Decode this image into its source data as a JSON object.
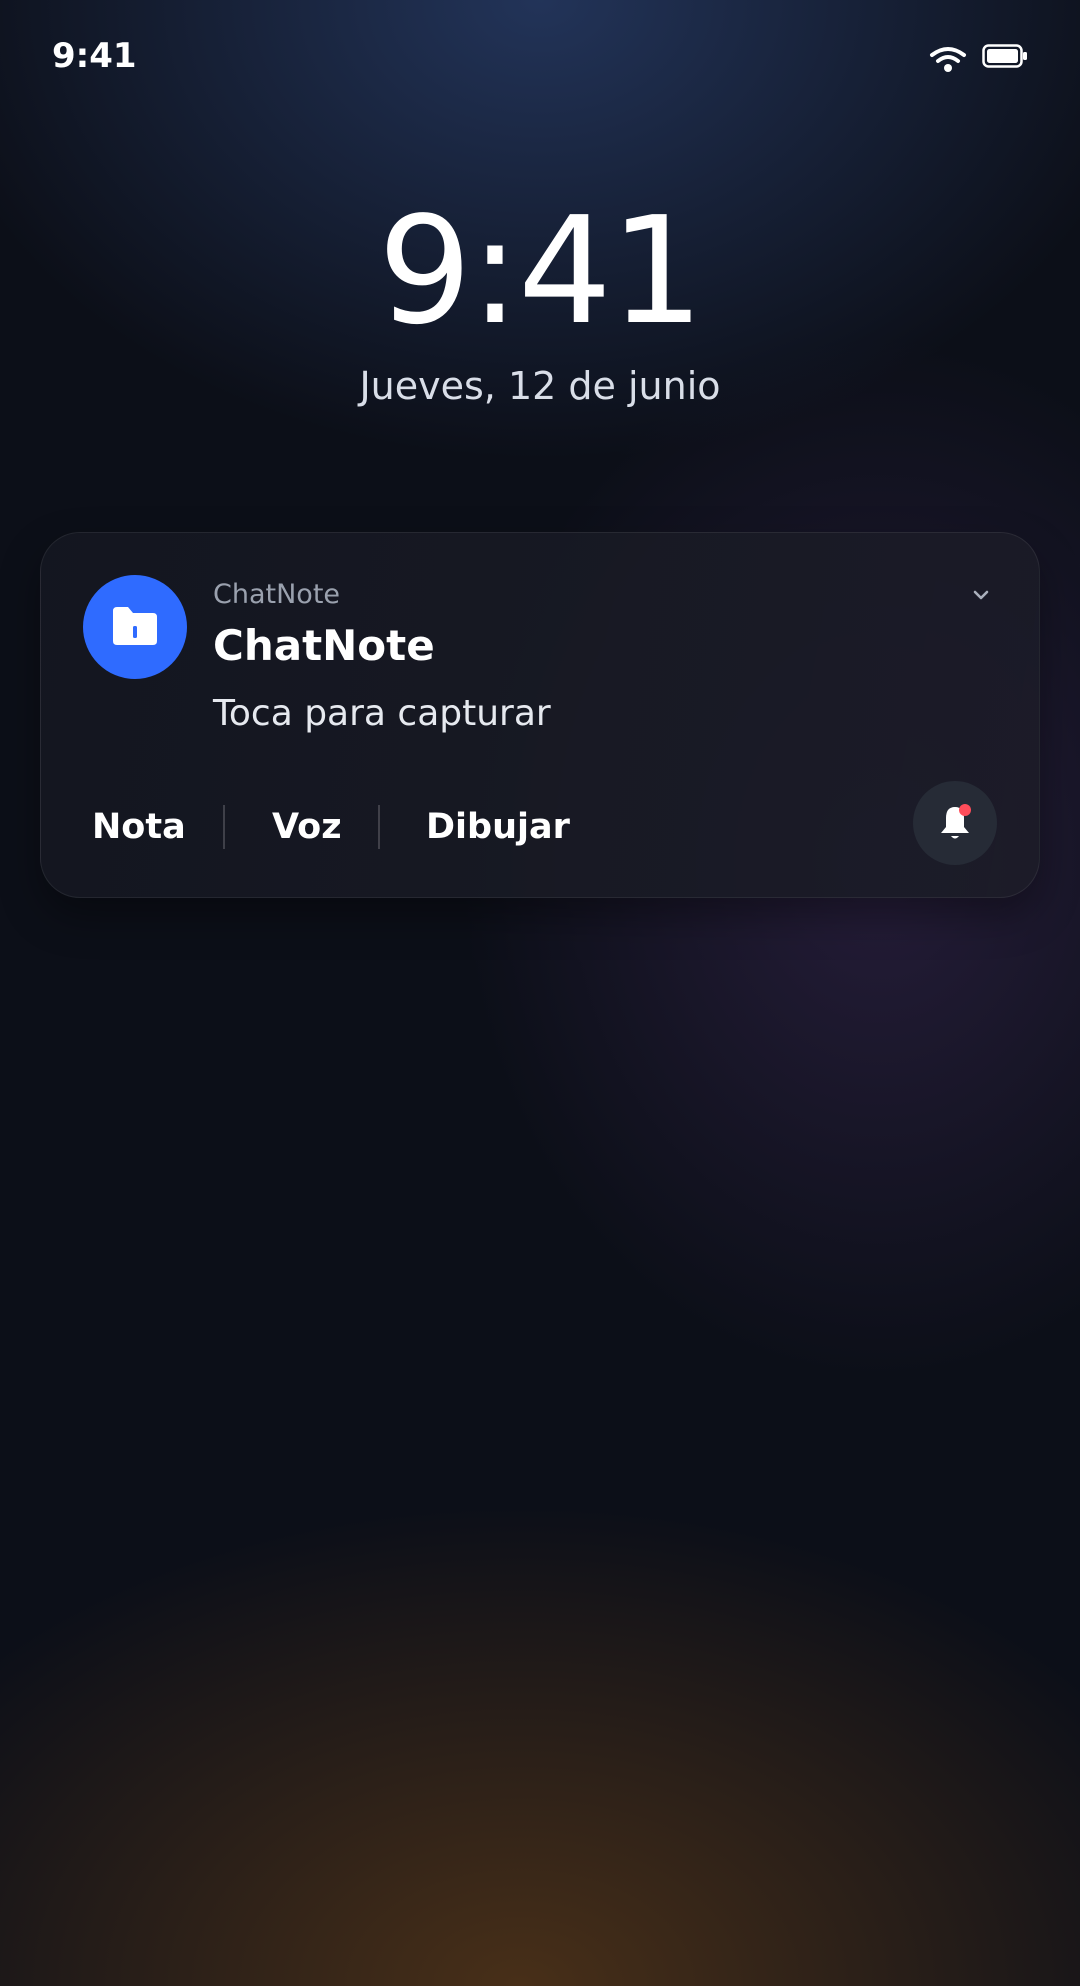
{
  "status_bar": {
    "time": "9:41",
    "icons": [
      "wifi-icon",
      "battery-icon"
    ]
  },
  "lock_screen": {
    "time": "9:41",
    "date": "Jueves, 12 de junio"
  },
  "notification": {
    "app_icon": "folder-icon",
    "app_icon_color": "#2f6bff",
    "app_name": "ChatNote",
    "title": "ChatNote",
    "body": "Toca para capturar",
    "expand_icon": "chevron-down-icon",
    "actions": [
      {
        "label": "Nota"
      },
      {
        "label": "Voz"
      },
      {
        "label": "Dibujar"
      }
    ],
    "bell_icon": "bell-icon",
    "bell_badge_color": "#ff4d5a"
  }
}
